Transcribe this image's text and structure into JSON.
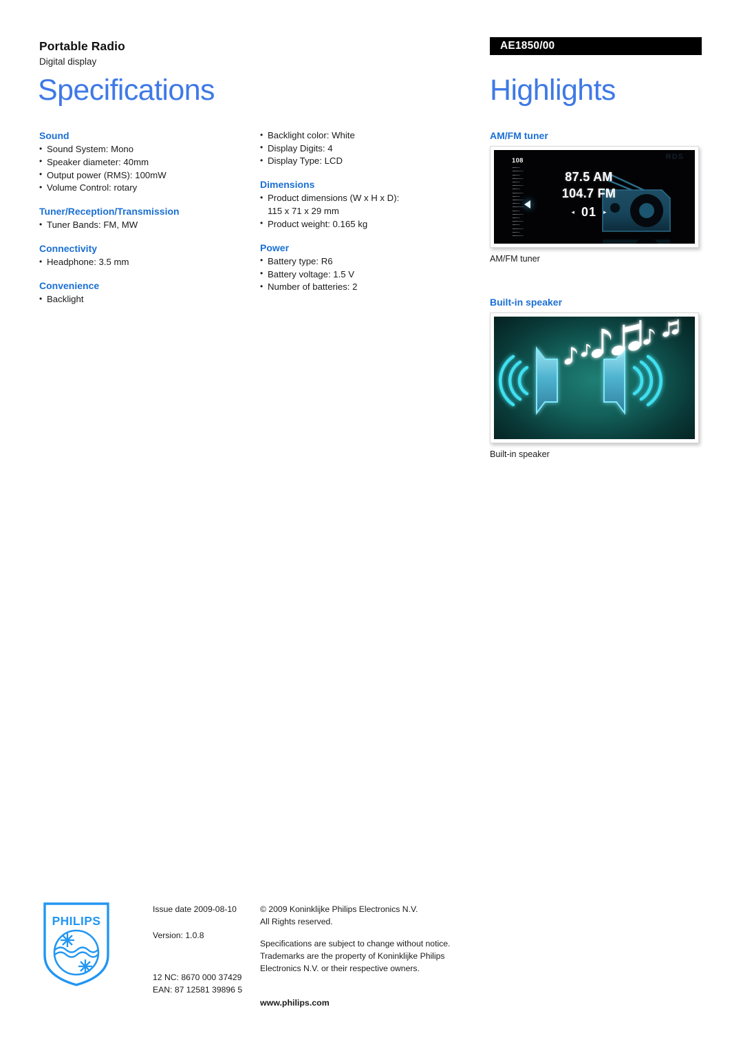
{
  "header": {
    "product_name": "Portable Radio",
    "product_subtitle": "Digital display",
    "spec_title": "Specifications",
    "highlights_title": "Highlights",
    "product_code": "AE1850/00"
  },
  "specs": {
    "column1": [
      {
        "heading": "Sound",
        "items": [
          "Sound System: Mono",
          "Speaker diameter: 40mm",
          "Output power (RMS): 100mW",
          "Volume Control: rotary"
        ]
      },
      {
        "heading": "Tuner/Reception/Transmission",
        "items": [
          "Tuner Bands: FM, MW"
        ]
      },
      {
        "heading": "Connectivity",
        "items": [
          "Headphone: 3.5 mm"
        ]
      },
      {
        "heading": "Convenience",
        "items": [
          "Backlight"
        ]
      }
    ],
    "column2": [
      {
        "heading": "",
        "items": [
          "Backlight color: White",
          "Display Digits: 4",
          "Display Type: LCD"
        ]
      },
      {
        "heading": "Dimensions",
        "items": [
          "Product dimensions (W x H x D):",
          "Product weight: 0.165 kg"
        ],
        "continuation": "115 x 71 x 29 mm"
      },
      {
        "heading": "Power",
        "items": [
          "Battery type: R6",
          "Battery voltage: 1.5 V",
          "Number of batteries: 2"
        ]
      }
    ]
  },
  "highlights": [
    {
      "heading": "AM/FM tuner",
      "caption": "AM/FM tuner",
      "artwork": {
        "scale_top_label": "108",
        "frequency_am": "87.5 AM",
        "frequency_fm": "104.7 FM",
        "preset_number": "01",
        "preset_prev_icon": "◂",
        "preset_next_icon": "▸",
        "rds_label": "RDS"
      }
    },
    {
      "heading": "Built-in speaker",
      "caption": "Built-in speaker"
    }
  ],
  "footer": {
    "issue_date": "Issue date 2009-08-10",
    "version": "Version: 1.0.8",
    "nc_code": "12 NC: 8670 000 37429",
    "ean": "EAN: 87 12581 39896 5",
    "copyright_line1": "© 2009 Koninklijke Philips Electronics N.V.",
    "copyright_line2": "All Rights reserved.",
    "disclaimer_line1": "Specifications are subject to change without notice.",
    "disclaimer_line2": "Trademarks are the property of Koninklijke Philips",
    "disclaimer_line3": "Electronics N.V. or their respective owners.",
    "website": "www.philips.com",
    "logo_wordmark": "PHILIPS"
  },
  "colors": {
    "title_blue": "#3f79e6",
    "heading_blue": "#1a6fd4",
    "code_bar_bg": "#000000",
    "tuner_bg": "#030305",
    "speaker_teal": "#1f7f74"
  }
}
